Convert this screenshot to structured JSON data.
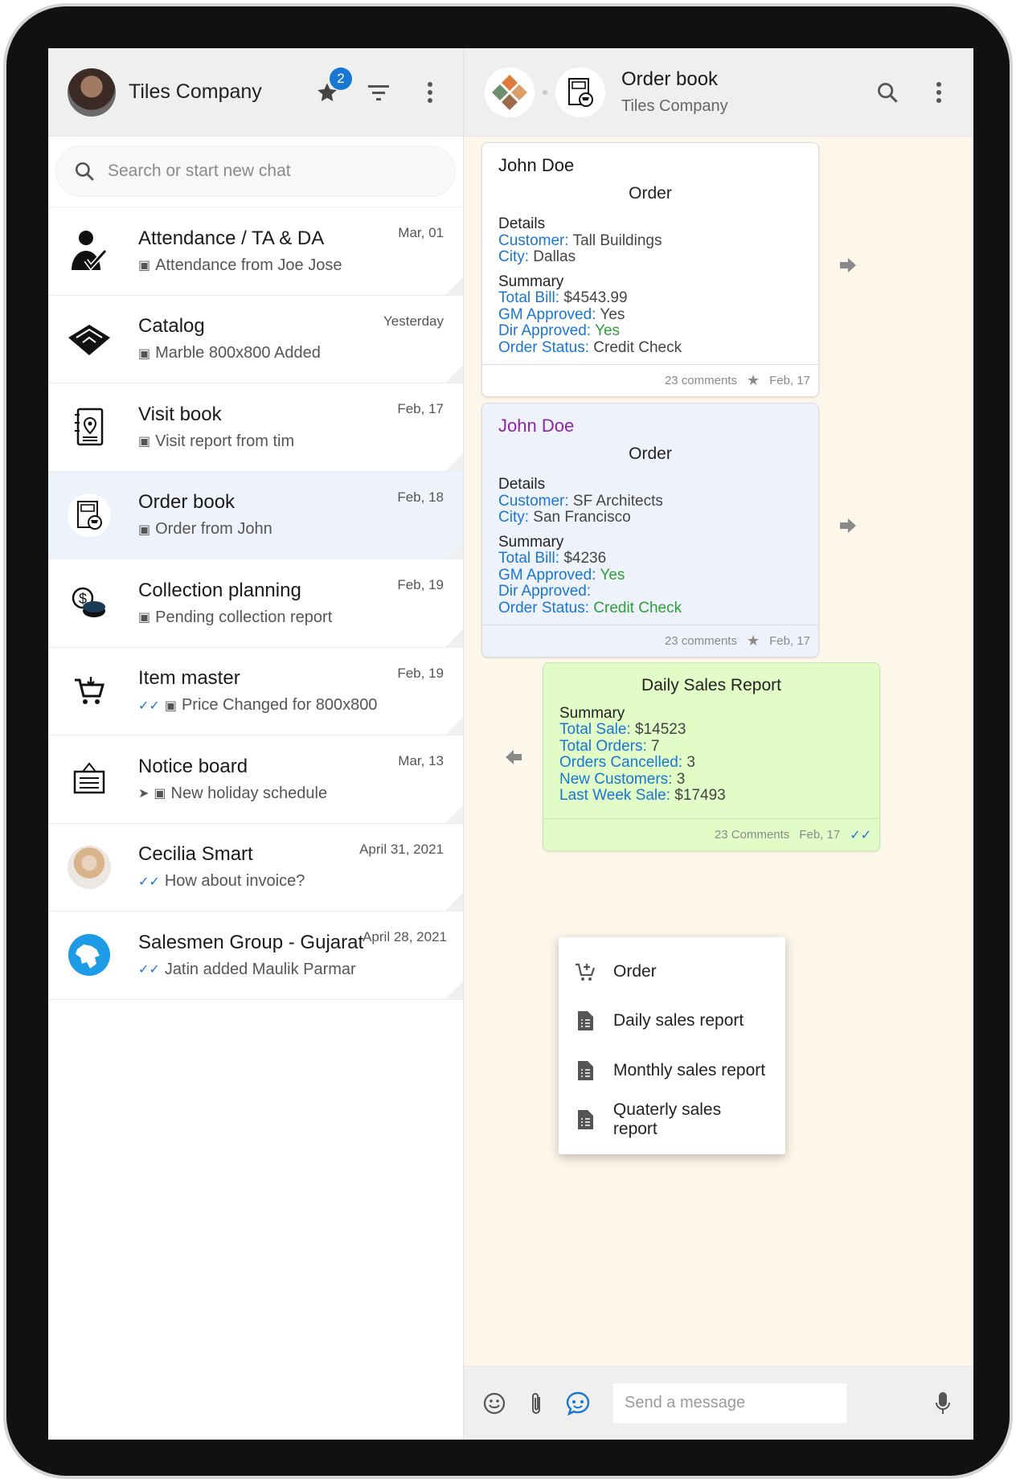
{
  "left_header": {
    "company": "Tiles Company",
    "star_badge": "2"
  },
  "search": {
    "placeholder": "Search or start new chat"
  },
  "chats": [
    {
      "name": "Attendance / TA & DA",
      "preview": "Attendance from Joe Jose",
      "date": "Mar, 01",
      "icon": "attendance-icon",
      "status": ""
    },
    {
      "name": "Catalog",
      "preview": "Marble 800x800 Added",
      "date": "Yesterday",
      "icon": "catalog-icon",
      "status": ""
    },
    {
      "name": "Visit book",
      "preview": "Visit report from tim",
      "date": "Feb, 17",
      "icon": "visit-book-icon",
      "status": ""
    },
    {
      "name": "Order book",
      "preview": "Order from John",
      "date": "Feb, 18",
      "icon": "order-book-icon",
      "status": ""
    },
    {
      "name": "Collection planning",
      "preview": "Pending collection report",
      "date": "Feb, 19",
      "icon": "collection-icon",
      "status": ""
    },
    {
      "name": "Item master",
      "preview": "Price Changed for 800x800",
      "date": "Feb, 19",
      "icon": "cart-icon",
      "status": "read"
    },
    {
      "name": "Notice board",
      "preview": "New holiday schedule",
      "date": "Mar, 13",
      "icon": "notice-board-icon",
      "status": "sent"
    },
    {
      "name": "Cecilia Smart",
      "preview": "How about invoice?",
      "date": "April 31, 2021",
      "icon": "avatar",
      "status": "read"
    },
    {
      "name": "Salesmen Group - Gujarat",
      "preview": "Jatin added Maulik Parmar",
      "date": "April 28, 2021",
      "icon": "group-map-icon",
      "status": "read"
    }
  ],
  "chat_header": {
    "title": "Order book",
    "subtitle": "Tiles Company"
  },
  "messages": [
    {
      "from": "John Doe",
      "title": "Order",
      "details_label": "Details",
      "details": [
        {
          "k": "Customer:",
          "v": "Tall Buildings"
        },
        {
          "k": "City:",
          "v": "Dallas"
        }
      ],
      "summary_label": "Summary",
      "summary": [
        {
          "k": "Total Bill:",
          "v": "$4543.99"
        },
        {
          "k": "GM Approved:",
          "v": "Yes"
        },
        {
          "k": "Dir Approved:",
          "v": "Yes"
        },
        {
          "k": "Order Status:",
          "v": "Credit Check"
        }
      ],
      "comments": "23 comments",
      "date": "Feb, 17"
    },
    {
      "from": "John Doe",
      "title": "Order",
      "details_label": "Details",
      "details": [
        {
          "k": "Customer:",
          "v": "SF Architects"
        },
        {
          "k": "City:",
          "v": "San Francisco"
        }
      ],
      "summary_label": "Summary",
      "summary": [
        {
          "k": "Total Bill:",
          "v": "$4236"
        },
        {
          "k": "GM Approved:",
          "v": "Yes"
        },
        {
          "k": "Dir Approved:",
          "v": ""
        },
        {
          "k": "Order Status:",
          "v": "Credit Check"
        }
      ],
      "comments": "23 comments",
      "date": "Feb, 17"
    },
    {
      "title": "Daily Sales Report",
      "summary_label": "Summary",
      "summary": [
        {
          "k": "Total Sale:",
          "v": "$14523"
        },
        {
          "k": "Total Orders:",
          "v": "7"
        },
        {
          "k": "Orders Cancelled:",
          "v": "3"
        },
        {
          "k": "New Customers:",
          "v": "3"
        },
        {
          "k": "Last Week Sale:",
          "v": "$17493"
        }
      ],
      "comments": "23 Comments",
      "date": "Feb, 17"
    }
  ],
  "menu": [
    {
      "label": "Order",
      "icon": "add-cart-icon"
    },
    {
      "label": "Daily sales report",
      "icon": "report-icon"
    },
    {
      "label": "Monthly sales report",
      "icon": "report-icon"
    },
    {
      "label": "Quaterly sales report",
      "icon": "report-icon"
    }
  ],
  "composer": {
    "placeholder": "Send a message"
  },
  "colors": {
    "accent": "#1976d2",
    "green": "#2e9d3a",
    "purple": "#8e24aa",
    "chat_bg": "#fdf6ea",
    "report_bubble": "#e2fcc8"
  }
}
